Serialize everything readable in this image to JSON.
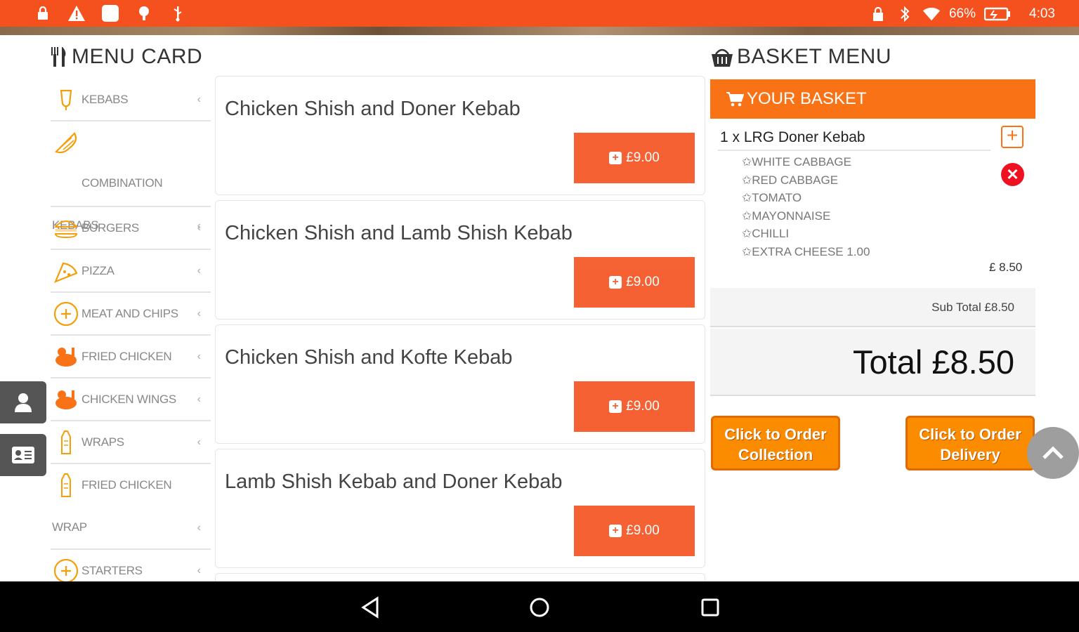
{
  "status_bar": {
    "battery": "66%",
    "time": "4:03",
    "left_icons": [
      "lock-icon",
      "warning-icon",
      "app-icon",
      "location-icon",
      "usb-icon"
    ],
    "right_icons": [
      "lock-icon",
      "bluetooth-icon",
      "wifi-icon",
      "battery-icon"
    ]
  },
  "menu_card": {
    "title": "MENU CARD",
    "categories": [
      {
        "label": "KEBABS",
        "icon": "kebab-icon"
      },
      {
        "label": "COMBINATION",
        "label2": "KEBABS",
        "icon": "combination-icon"
      },
      {
        "label": "BURGERS",
        "icon": "burger-icon"
      },
      {
        "label": "PIZZA",
        "icon": "pizza-icon"
      },
      {
        "label": "MEAT AND CHIPS",
        "icon": "plus-circle-icon"
      },
      {
        "label": "FRIED CHICKEN",
        "icon": "chicken-icon"
      },
      {
        "label": "CHICKEN WINGS",
        "icon": "chicken-icon"
      },
      {
        "label": "WRAPS",
        "icon": "wrap-icon"
      },
      {
        "label": "FRIED CHICKEN",
        "label2": "WRAP",
        "icon": "wrap-icon"
      },
      {
        "label": "STARTERS",
        "icon": "plus-circle-icon"
      }
    ]
  },
  "items": [
    {
      "name": "Chicken Shish and Doner Kebab",
      "price": "£9.00"
    },
    {
      "name": "Chicken Shish and Lamb Shish Kebab",
      "price": "£9.00"
    },
    {
      "name": "Chicken Shish and Kofte Kebab",
      "price": "£9.00"
    },
    {
      "name": "Lamb Shish Kebab and Doner Kebab",
      "price": "£9.00"
    }
  ],
  "basket": {
    "title": "BASKET MENU",
    "header": "YOUR BASKET",
    "line": "1 x LRG Doner Kebab",
    "options": [
      "✩WHITE CABBAGE",
      "✩RED CABBAGE",
      "✩TOMATO",
      "✩MAYONNAISE",
      "✩CHILLI",
      "✩EXTRA CHEESE 1.00"
    ],
    "line_price": "£ 8.50",
    "subtotal": "Sub Total £8.50",
    "total": "Total £8.50",
    "collection_line1": "Click to Order",
    "collection_line2": "Collection",
    "delivery_line1": "Click to Order",
    "delivery_line2": "Delivery"
  },
  "colors": {
    "accent": "#f4511e",
    "basket_header": "#f97316",
    "order_button": "#fb8c00"
  }
}
